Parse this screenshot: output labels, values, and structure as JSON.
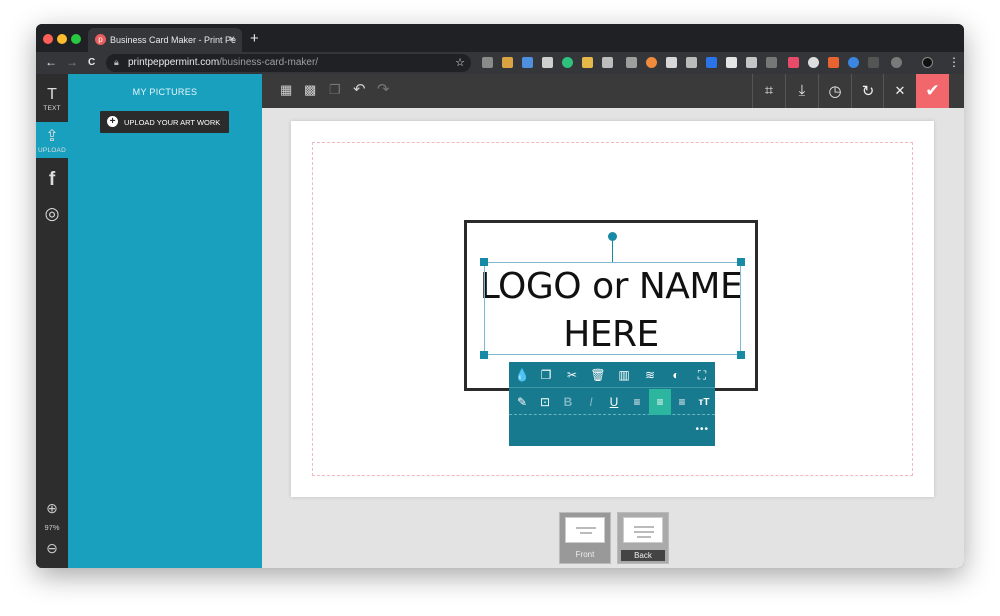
{
  "browser": {
    "tab_title": "Business Card Maker - Print Pe",
    "tab_close": "×",
    "new_tab": "+",
    "url_domain": "printpeppermint.com",
    "url_path": "/business-card-maker/",
    "back": "←",
    "forward": "→",
    "reload": "C",
    "star": "☆",
    "menu": "⋮"
  },
  "sidebar": {
    "items": [
      {
        "icon": "T",
        "label": "TEXT"
      },
      {
        "icon": "⇪",
        "label": "UPLOAD"
      },
      {
        "icon": "f",
        "label": ""
      },
      {
        "icon": "◎",
        "label": ""
      }
    ],
    "zoom_in": "⊕",
    "zoom_level": "97%",
    "zoom_out": "⊖"
  },
  "panel": {
    "title": "MY PICTURES",
    "upload_label": "UPLOAD YOUR ART WORK",
    "upload_icon": "+"
  },
  "toolbar": {
    "left_icons": [
      "▦",
      "▩",
      "❐",
      "↶",
      "↷"
    ],
    "crop": "⌗",
    "download": "⤓",
    "history": "◷",
    "refresh": "↻",
    "close": "✕",
    "confirm": "✔"
  },
  "canvas": {
    "text_line1": "LOGO or NAME",
    "text_line2": "HERE"
  },
  "popup": {
    "row1": [
      "💧",
      "❐",
      "✂",
      "🗑",
      "▥",
      "≋",
      "◐",
      "⛶"
    ],
    "row2": [
      "✎",
      "⊡",
      "B",
      "I",
      "U",
      "≡",
      "≡",
      "≡",
      "тT"
    ],
    "more": "•••"
  },
  "pages": {
    "front": "Front",
    "back": "Back"
  },
  "colors": {
    "accent": "#1aa0bf",
    "popup": "#177a8f",
    "confirm": "#f2676b"
  }
}
